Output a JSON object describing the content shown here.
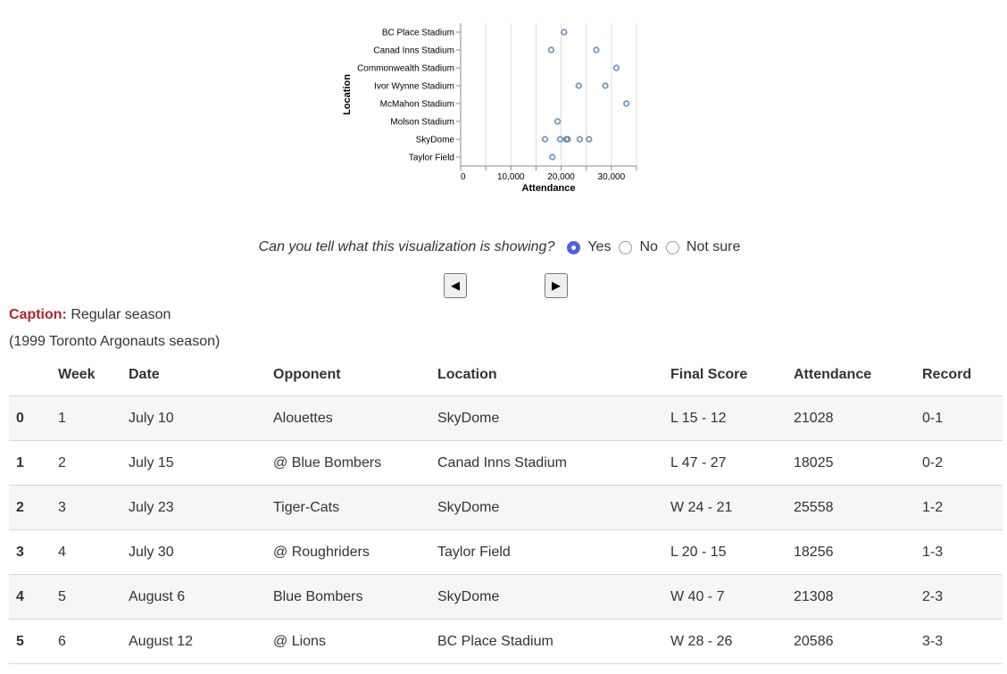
{
  "chart_data": {
    "type": "scatter",
    "xlabel": "Attendance",
    "ylabel": "Location",
    "x_ticks": [
      "0",
      "10,000",
      "20,000",
      "30,000"
    ],
    "xlim": [
      0,
      35000
    ],
    "grid": true,
    "categories": [
      "BC Place Stadium",
      "Canad Inns Stadium",
      "Commonwealth Stadium",
      "Ivor Wynne Stadium",
      "McMahon Stadium",
      "Molson Stadium",
      "SkyDome",
      "Taylor Field"
    ],
    "points": [
      {
        "location": "BC Place Stadium",
        "attendance": 20586
      },
      {
        "location": "Canad Inns Stadium",
        "attendance": 18025
      },
      {
        "location": "Canad Inns Stadium",
        "attendance": 27000
      },
      {
        "location": "Commonwealth Stadium",
        "attendance": 31000
      },
      {
        "location": "Ivor Wynne Stadium",
        "attendance": 23500
      },
      {
        "location": "Ivor Wynne Stadium",
        "attendance": 28800
      },
      {
        "location": "McMahon Stadium",
        "attendance": 33000
      },
      {
        "location": "Molson Stadium",
        "attendance": 19300
      },
      {
        "location": "SkyDome",
        "attendance": 16800
      },
      {
        "location": "SkyDome",
        "attendance": 19800
      },
      {
        "location": "SkyDome",
        "attendance": 21028
      },
      {
        "location": "SkyDome",
        "attendance": 21308
      },
      {
        "location": "SkyDome",
        "attendance": 23700
      },
      {
        "location": "SkyDome",
        "attendance": 25558
      },
      {
        "location": "Taylor Field",
        "attendance": 18256
      }
    ],
    "point_color": "#4c78a8"
  },
  "question": {
    "text": "Can you tell what this visualization is showing?",
    "options": [
      "Yes",
      "No",
      "Not sure"
    ],
    "selected": "Yes"
  },
  "nav": {
    "prev": "◀",
    "next": "▶"
  },
  "caption": {
    "label": "Caption:",
    "text": "Regular season",
    "subtitle": "(1999 Toronto Argonauts season)"
  },
  "table": {
    "columns": [
      "",
      "Week",
      "Date",
      "Opponent",
      "Location",
      "Final Score",
      "Attendance",
      "Record"
    ],
    "rows": [
      [
        "0",
        "1",
        "July 10",
        "Alouettes",
        "SkyDome",
        "L 15 - 12",
        "21028",
        "0-1"
      ],
      [
        "1",
        "2",
        "July 15",
        "@ Blue Bombers",
        "Canad Inns Stadium",
        "L 47 - 27",
        "18025",
        "0-2"
      ],
      [
        "2",
        "3",
        "July 23",
        "Tiger-Cats",
        "SkyDome",
        "W 24 - 21",
        "25558",
        "1-2"
      ],
      [
        "3",
        "4",
        "July 30",
        "@ Roughriders",
        "Taylor Field",
        "L 20 - 15",
        "18256",
        "1-3"
      ],
      [
        "4",
        "5",
        "August 6",
        "Blue Bombers",
        "SkyDome",
        "W 40 - 7",
        "21308",
        "2-3"
      ],
      [
        "5",
        "6",
        "August 12",
        "@ Lions",
        "BC Place Stadium",
        "W 28 - 26",
        "20586",
        "3-3"
      ]
    ]
  },
  "colors": {
    "caption_label": "#b0242a",
    "radio_selected": "#4e62d9",
    "row_stripe": "#f5f6f8"
  }
}
